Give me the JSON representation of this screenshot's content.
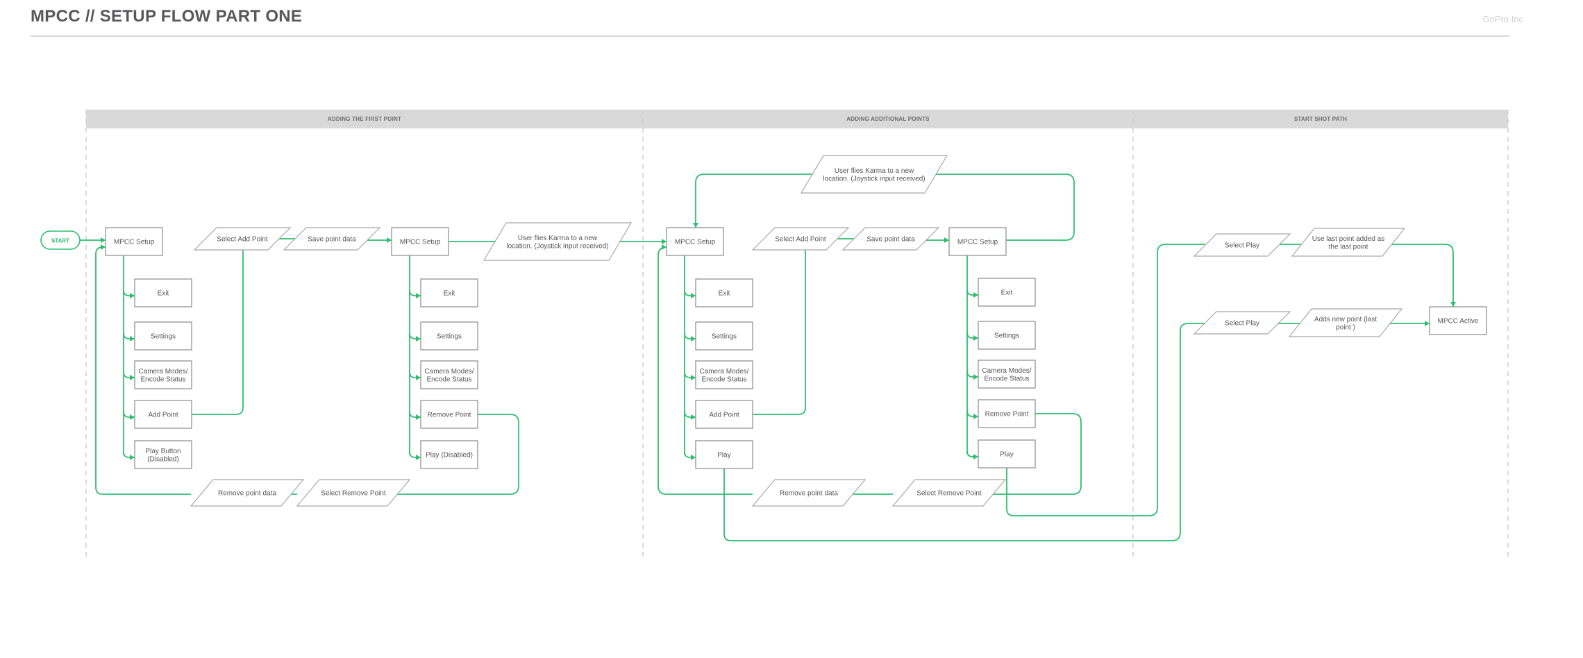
{
  "title": "MPCC // SETUP FLOW PART ONE",
  "company": "GoPro Inc",
  "colors": {
    "flow": "#2dbf70",
    "header_band": "#d9d9d9",
    "box_border": "#8a8a8a",
    "title": "#58585a"
  },
  "lanes": [
    {
      "id": "lane-first",
      "title": "ADDING THE FIRST POINT"
    },
    {
      "id": "lane-additional",
      "title": "ADDING ADDITIONAL POINTS"
    },
    {
      "id": "lane-start",
      "title": "START SHOT PATH"
    }
  ],
  "nodes": {
    "start": [
      "START"
    ],
    "a_setup": [
      "MPCC Setup"
    ],
    "a_exit": [
      "Exit"
    ],
    "a_settings": [
      "Settings"
    ],
    "a_camera": [
      "Camera Modes/",
      "Encode Status"
    ],
    "a_add": [
      "Add Point"
    ],
    "a_play": [
      "Play Button",
      "(Disabled)"
    ],
    "a_sel_add": [
      "Select Add Point"
    ],
    "a_save": [
      "Save point data"
    ],
    "a_remove_data": [
      "Remove point data"
    ],
    "a_sel_remove": [
      "Select Remove Point"
    ],
    "b_setup": [
      "MPCC Setup"
    ],
    "b_exit": [
      "Exit"
    ],
    "b_settings": [
      "Settings"
    ],
    "b_camera": [
      "Camera Modes/",
      "Encode Status"
    ],
    "b_remove": [
      "Remove Point"
    ],
    "b_play": [
      "Play (Disabled)"
    ],
    "b_flies": [
      "User flies Karma to a new",
      "location. (Joystick input received)"
    ],
    "c_setup": [
      "MPCC Setup"
    ],
    "c_exit": [
      "Exit"
    ],
    "c_settings": [
      "Settings"
    ],
    "c_camera": [
      "Camera Modes/",
      "Encode Status"
    ],
    "c_add": [
      "Add Point"
    ],
    "c_play": [
      "Play"
    ],
    "c_sel_add": [
      "Select Add Point"
    ],
    "c_save": [
      "Save point data"
    ],
    "c_flies": [
      "User flies Karma to a new",
      "location. (Joystick input received)"
    ],
    "c_remove_data": [
      "Remove point data"
    ],
    "c_sel_remove": [
      "Select Remove Point"
    ],
    "d_setup": [
      "MPCC Setup"
    ],
    "d_exit": [
      "Exit"
    ],
    "d_settings": [
      "Settings"
    ],
    "d_camera": [
      "Camera Modes/",
      "Encode Status"
    ],
    "d_remove": [
      "Remove Point"
    ],
    "d_play": [
      "Play"
    ],
    "e_sel_play1": [
      "Select Play"
    ],
    "e_use_last": [
      "Use last point added as",
      "the last point"
    ],
    "e_sel_play2": [
      "Select Play"
    ],
    "e_adds_new": [
      "Adds new point (last",
      "point )"
    ],
    "e_active": [
      "MPCC Active"
    ]
  }
}
